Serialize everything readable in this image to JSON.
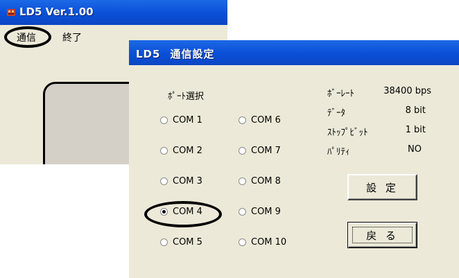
{
  "main_window": {
    "title": "LD5  Ver.1.00",
    "menu": {
      "comm_label": "通信",
      "quit_label": "終了"
    }
  },
  "dialog": {
    "title": "LD5",
    "subtitle": "通信設定",
    "port_label": "ﾎﾟｰﾄ選択",
    "ports": [
      {
        "label": "COM 1",
        "checked": false
      },
      {
        "label": "COM 2",
        "checked": false
      },
      {
        "label": "COM 3",
        "checked": false
      },
      {
        "label": "COM 4",
        "checked": true
      },
      {
        "label": "COM 5",
        "checked": false
      },
      {
        "label": "COM 6",
        "checked": false
      },
      {
        "label": "COM 7",
        "checked": false
      },
      {
        "label": "COM 8",
        "checked": false
      },
      {
        "label": "COM 9",
        "checked": false
      },
      {
        "label": "COM 10",
        "checked": false
      }
    ],
    "settings": [
      {
        "label": "ﾎﾞｰﾚｰﾄ",
        "value": "38400 bps"
      },
      {
        "label": "ﾃﾞｰﾀ",
        "value": "8 bit"
      },
      {
        "label": "ｽﾄｯﾌﾟﾋﾞｯﾄ",
        "value": "1 bit"
      },
      {
        "label": "ﾊﾟﾘﾃｨ",
        "value": "NO"
      }
    ],
    "set_button": "設 定",
    "back_button": "戻 る"
  },
  "colors": {
    "titlebar": "#0a4fd6",
    "face": "#ece9d8"
  }
}
